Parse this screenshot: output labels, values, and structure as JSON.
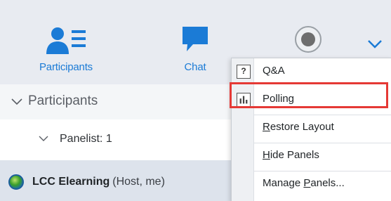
{
  "toolbar": {
    "participants_label": "Participants",
    "chat_label": "Chat",
    "icons": {
      "participants": "participants-list-icon",
      "chat": "chat-bubble-icon",
      "record": "record-icon",
      "more": "chevron-down-icon"
    }
  },
  "panel": {
    "header_label": "Participants",
    "panelist_label": "Panelist: 1",
    "attendee_name": "LCC Elearning",
    "attendee_role": "(Host, me)"
  },
  "menu": {
    "items": [
      {
        "label": "Q&A",
        "icon": "question-icon",
        "icon_glyph": "?"
      },
      {
        "label": "Polling",
        "icon": "poll-chart-icon",
        "highlighted": true
      },
      {
        "label_pre": "",
        "label_u": "R",
        "label_post": "estore Layout"
      },
      {
        "label_pre": "",
        "label_u": "H",
        "label_post": "ide Panels"
      },
      {
        "label_pre": "Manage ",
        "label_u": "P",
        "label_post": "anels..."
      }
    ]
  },
  "colors": {
    "accent_blue": "#1b7bd6",
    "highlight_red": "#e53935",
    "toolbar_bg": "#e8ebf1",
    "selected_row_bg": "#dde3ec"
  }
}
